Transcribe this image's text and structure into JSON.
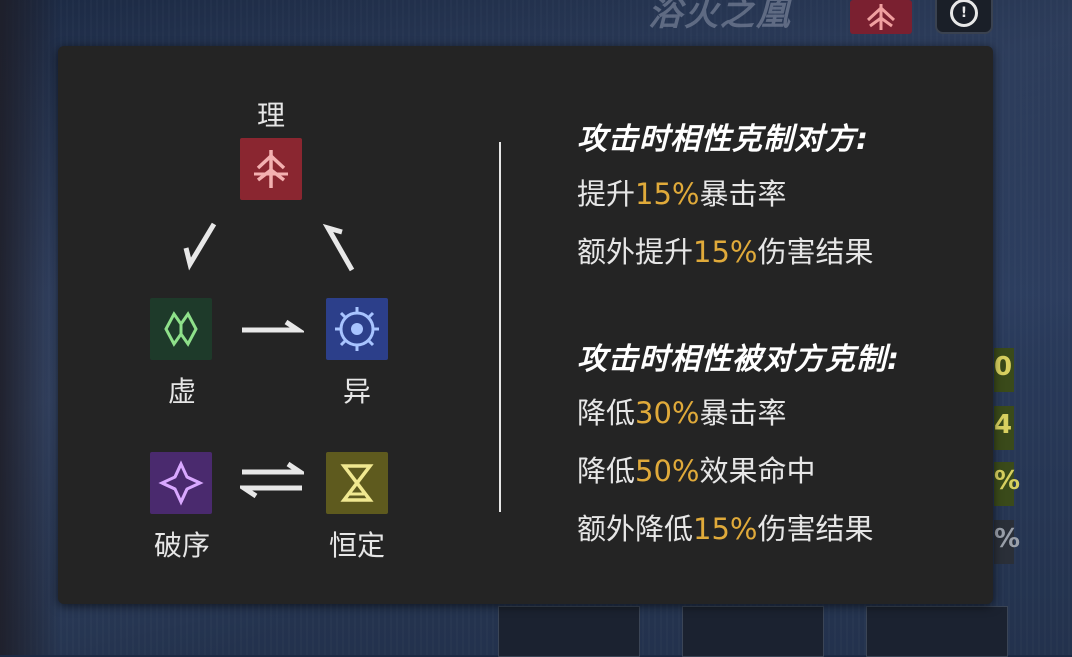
{
  "background": {
    "title": "浴火之凰",
    "info_icon": "info-icon",
    "stats": [
      "0",
      "4",
      "%",
      "%"
    ]
  },
  "diagram": {
    "top": {
      "label": "理",
      "icon": "physical-attr-icon",
      "color": "#8a2630"
    },
    "left": {
      "label": "虚",
      "icon": "imaginary-attr-icon",
      "color": "#1e3a2a"
    },
    "right": {
      "label": "异",
      "icon": "anomaly-attr-icon",
      "color": "#2c3f8a"
    },
    "bottom_left": {
      "label": "破序",
      "icon": "disorder-attr-icon",
      "color": "#4a2a6e"
    },
    "bottom_right": {
      "label": "恒定",
      "icon": "constant-attr-icon",
      "color": "#5e5a1e"
    }
  },
  "advantage": {
    "title": "攻击时相性克制对方:",
    "lines": [
      {
        "pre": "提升",
        "value": "15%",
        "post": "暴击率"
      },
      {
        "pre": "额外提升",
        "value": "15%",
        "post": "伤害结果"
      }
    ]
  },
  "disadvantage": {
    "title": "攻击时相性被对方克制:",
    "lines": [
      {
        "pre": "降低",
        "value": "30%",
        "post": "暴击率"
      },
      {
        "pre": "降低",
        "value": "50%",
        "post": "效果命中"
      },
      {
        "pre": "额外降低",
        "value": "15%",
        "post": "伤害结果"
      }
    ]
  },
  "highlight_color": "#e0aa3a"
}
